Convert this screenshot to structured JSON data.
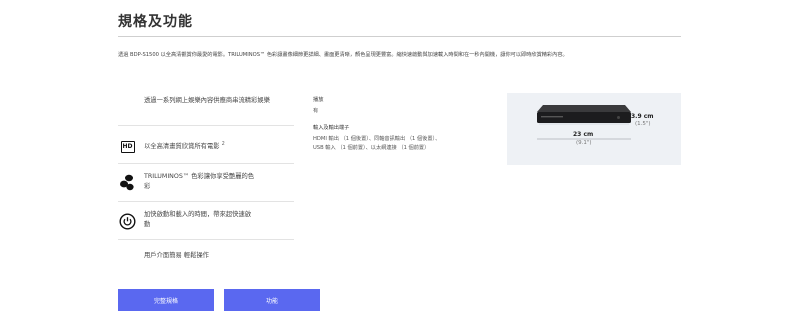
{
  "section": {
    "title": "規格及功能",
    "intro": "透過 BDP-S1500 以全高清觀賞你最愛的電影。TRILUMINOS™ 色彩讓畫像細節更詳細、畫面更清晰，顏色呈現更豐富。縮快速啟動與加速載入時間和在一秒內開機，讓你可以即時欣賞精彩內容。"
  },
  "features": [
    {
      "icon": "none",
      "label": "透過一系列網上娛樂內容供應商串流精彩娛樂"
    },
    {
      "icon": "hd-icon",
      "label": "以全高清畫質欣賞所有電影",
      "sup": "2"
    },
    {
      "icon": "triluminos-icon",
      "label": "TRILUMINOS™ 色彩讓你享受艷麗的色彩"
    },
    {
      "icon": "power-icon",
      "label": "加快啟動和載入的時間，帶來超快速啟動"
    },
    {
      "icon": "none",
      "label": "用戶介面簡易 輕鬆操作"
    }
  ],
  "icons": {
    "hd_text": "HD"
  },
  "specs": {
    "playback_label": "播放",
    "playback_value": "有",
    "io_label": "輸入及輸出端子",
    "io_value_line1": "HDMI 輸出 （1 個後置）、同軸音訊輸出 （1 個後置）、",
    "io_value_line2": "USB 輸入 （1 個前置）、以太網連接 （1 個前置）"
  },
  "product": {
    "height_cm": "3.9 cm",
    "height_in": "(1.5\")",
    "width_cm": "23 cm",
    "width_in": "(9.1\")"
  },
  "buttons": {
    "full_specs": "完整規格",
    "features": "功能"
  },
  "colors": {
    "accent": "#5a68f0",
    "product_bg": "#eef1f5"
  }
}
